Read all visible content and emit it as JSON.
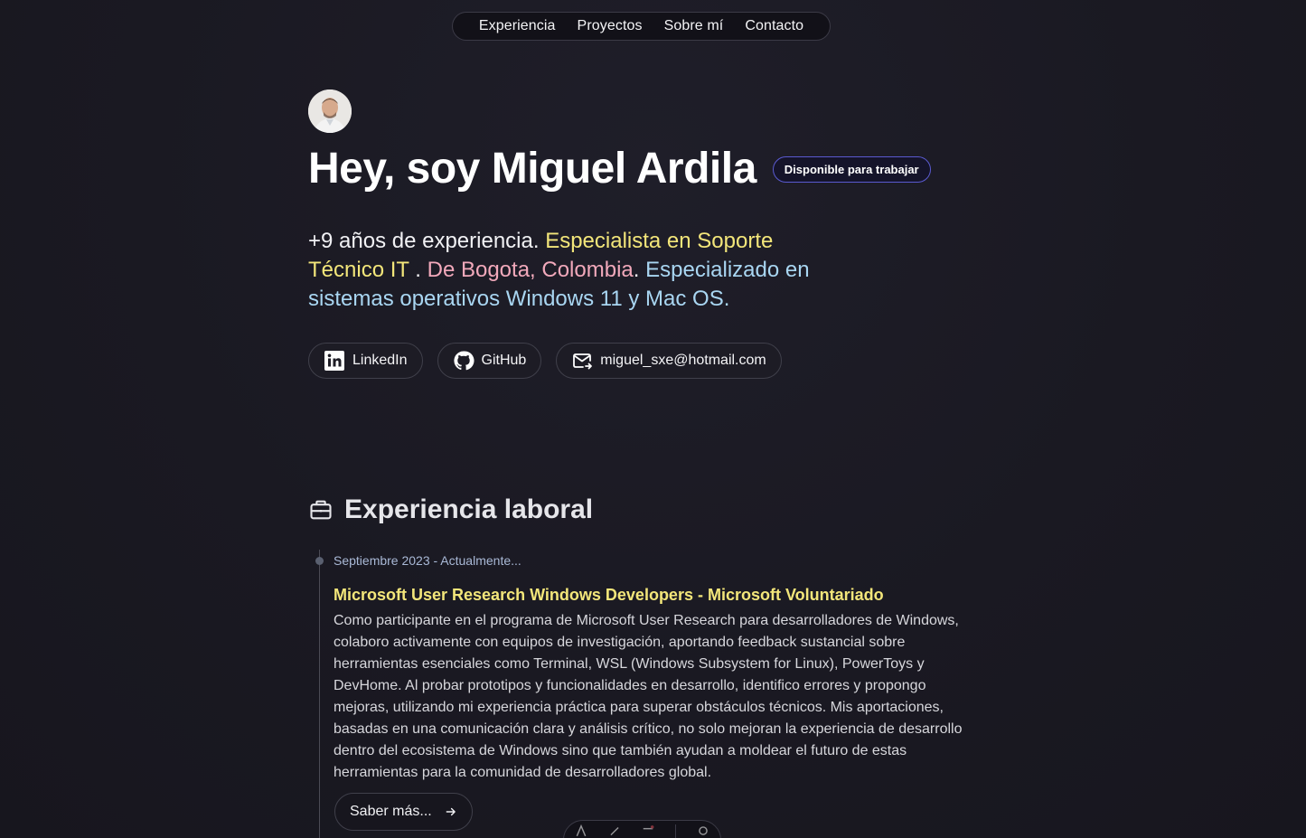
{
  "nav": {
    "items": [
      "Experiencia",
      "Proyectos",
      "Sobre mí",
      "Contacto"
    ]
  },
  "hero": {
    "title": "Hey, soy Miguel Ardila",
    "badge": "Disponible para trabajar",
    "intro": {
      "part1": "+9 años de experiencia. ",
      "part2": "Especialista en Soporte Técnico IT",
      "part3": " . ",
      "part4": "De Bogota, Colombia",
      "part5": ". ",
      "part6": "Especializado en sistemas operativos Windows 11 y Mac OS."
    },
    "links": [
      {
        "label": "LinkedIn",
        "icon": "linkedin-icon"
      },
      {
        "label": "GitHub",
        "icon": "github-icon"
      },
      {
        "label": "miguel_sxe@hotmail.com",
        "icon": "mail-icon"
      }
    ]
  },
  "experience": {
    "section_title": "Experiencia laboral",
    "items": [
      {
        "date": "Septiembre 2023 - Actualmente...",
        "role": "Microsoft User Research Windows Developers - Microsoft Voluntariado",
        "description": "Como participante en el programa de Microsoft User Research para desarrolladores de Windows, colaboro activamente con equipos de investigación, aportando feedback sustancial sobre herramientas esenciales como Terminal, WSL (Windows Subsystem for Linux), PowerToys y DevHome. Al probar prototipos y funcionalidades en desarrollo, identifico errores y propongo mejoras, utilizando mi experiencia práctica para superar obstáculos técnicos. Mis aportaciones, basadas en una comunicación clara y análisis crítico, no solo mejoran la experiencia de desarrollo dentro del ecosistema de Windows sino que también ayudan a moldear el futuro de estas herramientas para la comunidad de desarrolladores global.",
        "more_label": "Saber más..."
      }
    ]
  },
  "colors": {
    "background": "#1b1a23",
    "accent_yellow": "#f3e67a",
    "accent_pink": "#f2a9bb",
    "accent_blue": "#a9d6f2",
    "badge_border": "#5a5ad0"
  }
}
